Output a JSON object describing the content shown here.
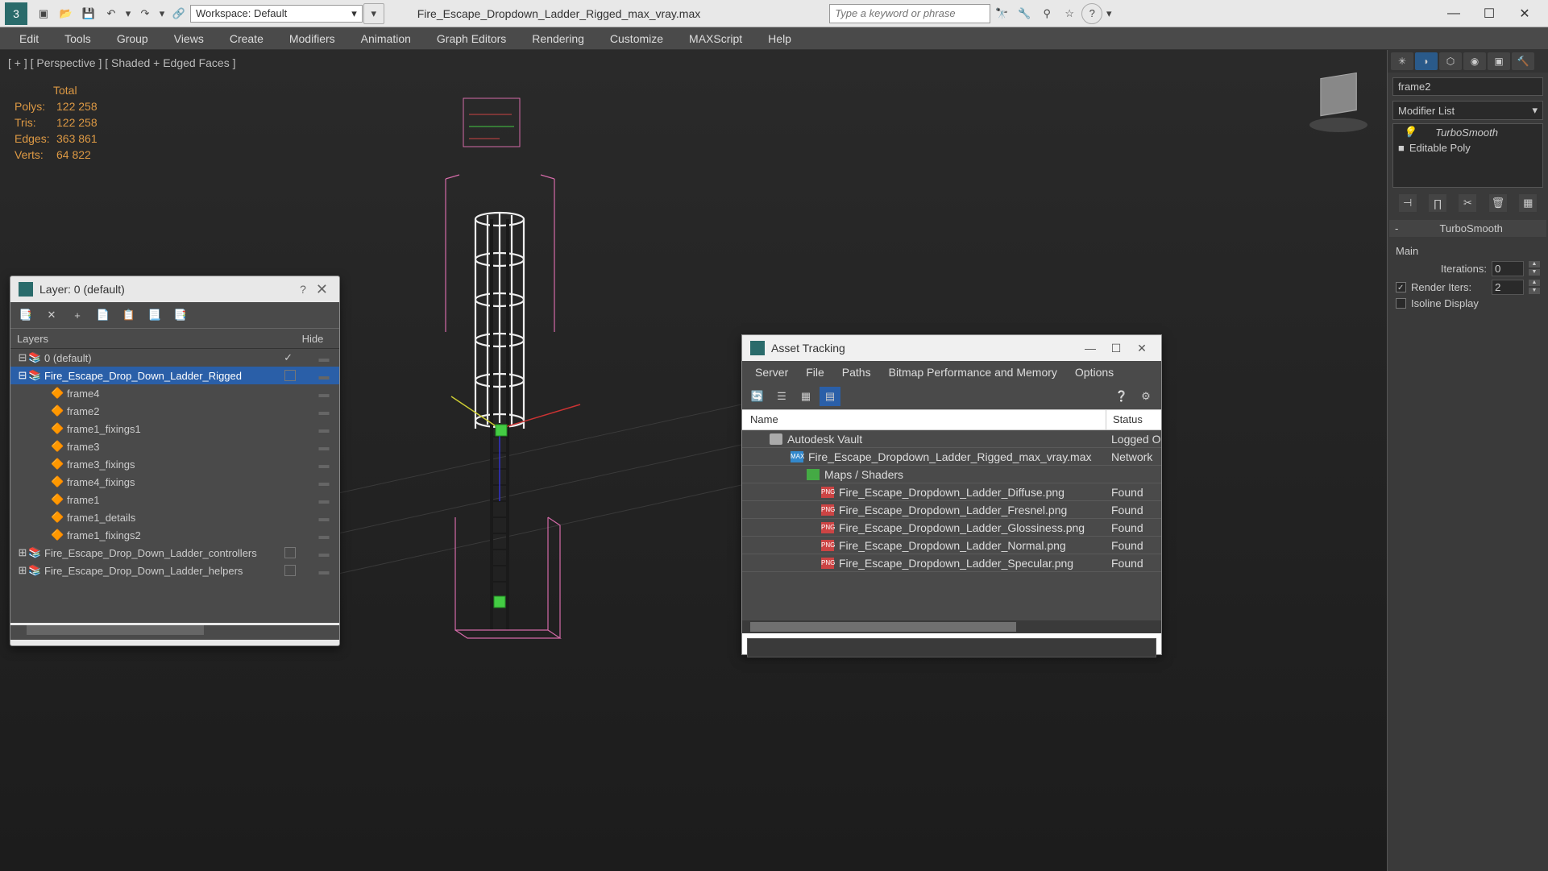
{
  "toolbar": {
    "workspace_label": "Workspace: Default",
    "filename": "Fire_Escape_Dropdown_Ladder_Rigged_max_vray.max",
    "search_placeholder": "Type a keyword or phrase"
  },
  "menu": [
    "Edit",
    "Tools",
    "Group",
    "Views",
    "Create",
    "Modifiers",
    "Animation",
    "Graph Editors",
    "Rendering",
    "Customize",
    "MAXScript",
    "Help"
  ],
  "viewport": {
    "label": "[ + ] [ Perspective ] [ Shaded + Edged Faces ]",
    "stats": {
      "total": "Total",
      "polys_label": "Polys:",
      "polys": "122 258",
      "tris_label": "Tris:",
      "tris": "122 258",
      "edges_label": "Edges:",
      "edges": "363 861",
      "verts_label": "Verts:",
      "verts": "64 822"
    }
  },
  "cmd_panel": {
    "obj_name": "frame2",
    "mod_list_label": "Modifier List",
    "stack": [
      "TurboSmooth",
      "Editable Poly"
    ],
    "rollout_title": "TurboSmooth",
    "main_label": "Main",
    "iterations_label": "Iterations:",
    "iterations_val": "0",
    "render_iters_label": "Render Iters:",
    "render_iters_val": "2",
    "isoline_label": "Isoline Display"
  },
  "layer_dialog": {
    "title": "Layer: 0 (default)",
    "col_layers": "Layers",
    "col_hide": "Hide",
    "rows": [
      {
        "indent": 0,
        "exp": "⊟",
        "name": "0 (default)",
        "sel": false,
        "check": true,
        "layer": true
      },
      {
        "indent": 0,
        "exp": "⊟",
        "name": "Fire_Escape_Drop_Down_Ladder_Rigged",
        "sel": true,
        "box": true,
        "layer": true
      },
      {
        "indent": 2,
        "exp": "",
        "name": "frame4",
        "sel": false,
        "box": false
      },
      {
        "indent": 2,
        "exp": "",
        "name": "frame2",
        "sel": false,
        "box": false
      },
      {
        "indent": 2,
        "exp": "",
        "name": "frame1_fixings1",
        "sel": false,
        "box": false
      },
      {
        "indent": 2,
        "exp": "",
        "name": "frame3",
        "sel": false,
        "box": false
      },
      {
        "indent": 2,
        "exp": "",
        "name": "frame3_fixings",
        "sel": false,
        "box": false
      },
      {
        "indent": 2,
        "exp": "",
        "name": "frame4_fixings",
        "sel": false,
        "box": false
      },
      {
        "indent": 2,
        "exp": "",
        "name": "frame1",
        "sel": false,
        "box": false
      },
      {
        "indent": 2,
        "exp": "",
        "name": "frame1_details",
        "sel": false,
        "box": false
      },
      {
        "indent": 2,
        "exp": "",
        "name": "frame1_fixings2",
        "sel": false,
        "box": false
      },
      {
        "indent": 0,
        "exp": "⊞",
        "name": "Fire_Escape_Drop_Down_Ladder_controllers",
        "sel": false,
        "box": true,
        "layer": true
      },
      {
        "indent": 0,
        "exp": "⊞",
        "name": "Fire_Escape_Drop_Down_Ladder_helpers",
        "sel": false,
        "box": true,
        "layer": true
      }
    ]
  },
  "asset_dialog": {
    "title": "Asset Tracking",
    "menu": [
      "Server",
      "File",
      "Paths",
      "Bitmap Performance and Memory",
      "Options"
    ],
    "col_name": "Name",
    "col_status": "Status",
    "rows": [
      {
        "indent": 20,
        "icon": "vault",
        "name": "Autodesk Vault",
        "status": "Logged O"
      },
      {
        "indent": 46,
        "icon": "max",
        "name": "Fire_Escape_Dropdown_Ladder_Rigged_max_vray.max",
        "status": "Network "
      },
      {
        "indent": 66,
        "icon": "map",
        "name": "Maps / Shaders",
        "status": ""
      },
      {
        "indent": 84,
        "icon": "png",
        "name": "Fire_Escape_Dropdown_Ladder_Diffuse.png",
        "status": "Found"
      },
      {
        "indent": 84,
        "icon": "png",
        "name": "Fire_Escape_Dropdown_Ladder_Fresnel.png",
        "status": "Found"
      },
      {
        "indent": 84,
        "icon": "png",
        "name": "Fire_Escape_Dropdown_Ladder_Glossiness.png",
        "status": "Found"
      },
      {
        "indent": 84,
        "icon": "png",
        "name": "Fire_Escape_Dropdown_Ladder_Normal.png",
        "status": "Found"
      },
      {
        "indent": 84,
        "icon": "png",
        "name": "Fire_Escape_Dropdown_Ladder_Specular.png",
        "status": "Found"
      }
    ]
  }
}
